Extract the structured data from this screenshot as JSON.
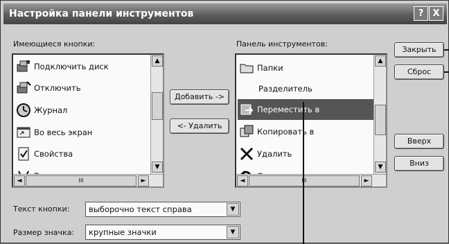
{
  "dialog": {
    "title": "Настройка панели инструментов",
    "help_label": "?",
    "close_label": "X"
  },
  "available": {
    "label": "Имеющиеся кнопки:",
    "items": [
      {
        "label": "Подключить диск",
        "icon": "map-drive-icon"
      },
      {
        "label": "Отключить",
        "icon": "disconnect-drive-icon"
      },
      {
        "label": "Журнал",
        "icon": "history-icon"
      },
      {
        "label": "Во весь экран",
        "icon": "fullscreen-icon"
      },
      {
        "label": "Свойства",
        "icon": "properties-icon"
      },
      {
        "label": "Выделить",
        "icon": "select-icon"
      }
    ],
    "scroll_mid_label": "III"
  },
  "toolbar_list": {
    "label": "Панель инструментов:",
    "items": [
      {
        "label": "Папки",
        "icon": "folders-icon"
      },
      {
        "label": "Разделитель",
        "icon": ""
      },
      {
        "label": "Переместить в",
        "icon": "move-to-icon",
        "selected": true
      },
      {
        "label": "Копировать в",
        "icon": "copy-to-icon"
      },
      {
        "label": "Удалить",
        "icon": "delete-icon"
      },
      {
        "label": "Отменить",
        "icon": "undo-icon"
      }
    ],
    "scroll_mid_label": "III"
  },
  "buttons": {
    "add": "Добавить ->",
    "remove": "<- Удалить",
    "close": "Закрыть",
    "reset": "Сброс",
    "up": "Вверх",
    "down": "Вниз"
  },
  "options": {
    "text_label": "Текст кнопки:",
    "text_value": "выборочно текст справа",
    "size_label": "Размер значка:",
    "size_value": "крупные значки"
  }
}
